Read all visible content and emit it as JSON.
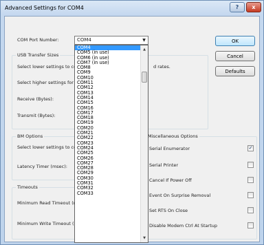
{
  "window": {
    "title": "Advanced Settings for COM4",
    "help_label": "?",
    "close_label": "x"
  },
  "com_port": {
    "label": "COM Port Number:",
    "value": "COM4"
  },
  "dropdown_options": [
    "COM4",
    "COM5 (in use)",
    "COM6 (in use)",
    "COM7 (in use)",
    "COM8",
    "COM9",
    "COM10",
    "COM11",
    "COM12",
    "COM13",
    "COM14",
    "COM15",
    "COM16",
    "COM17",
    "COM18",
    "COM19",
    "COM20",
    "COM21",
    "COM22",
    "COM23",
    "COM24",
    "COM25",
    "COM26",
    "COM27",
    "COM28",
    "COM29",
    "COM30",
    "COM31",
    "COM32",
    "COM33"
  ],
  "usb_transfer": {
    "title": "USB Transfer Sizes",
    "lower_text": "Select lower settings to corre",
    "lower_text_tail": "d rates.",
    "higher_text": "Select higher settings for fas",
    "receive_label": "Receive (Bytes):",
    "transmit_label": "Transmit (Bytes):"
  },
  "bm_options": {
    "title": "BM Options",
    "lower_text": "Select lower settings to corre",
    "latency_label": "Latency Timer (msec):"
  },
  "timeouts": {
    "title": "Timeouts",
    "read_label": "Minimum Read Timeout (mse",
    "write_label": "Minimum Write Timeout (mse"
  },
  "misc": {
    "title": "Miscellaneous Options",
    "options": [
      {
        "label": "Serial Enumerator",
        "checked": true
      },
      {
        "label": "Serial Printer",
        "checked": false
      },
      {
        "label": "Cancel If Power Off",
        "checked": false
      },
      {
        "label": "Event On Surprise Removal",
        "checked": false
      },
      {
        "label": "Set RTS On Close",
        "checked": false
      },
      {
        "label": "Disable Modem Ctrl At Startup",
        "checked": false
      }
    ]
  },
  "buttons": {
    "ok": "OK",
    "cancel": "Cancel",
    "defaults": "Defaults"
  },
  "glyphs": {
    "dropdown_arrow": "▼",
    "scroll_up": "▲",
    "scroll_down": "▼",
    "check": "✓"
  }
}
